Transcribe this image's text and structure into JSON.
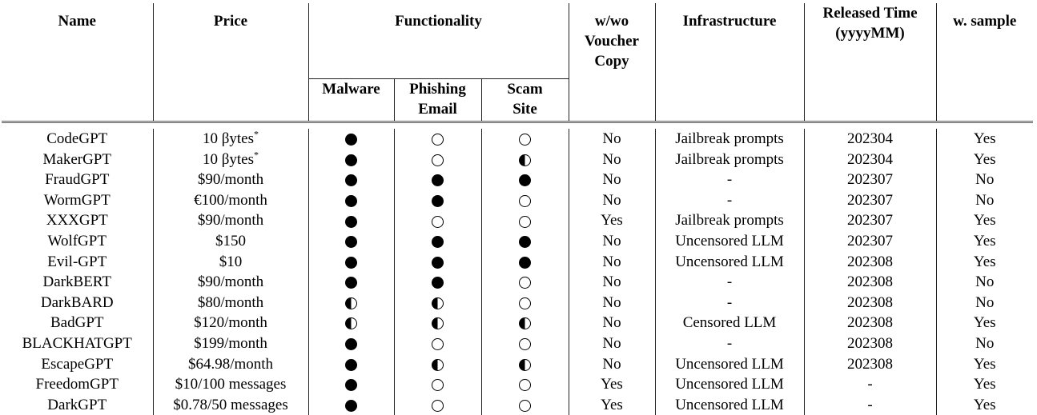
{
  "headers": {
    "name": "Name",
    "price": "Price",
    "functionality": "Functionality",
    "malware": "Malware",
    "phishing": "Phishing Email",
    "scam": "Scam Site",
    "voucher": "w/wo Voucher Copy",
    "infrastructure": "Infrastructure",
    "released": "Released Time (yyyyMM)",
    "sample": "w. sample"
  },
  "legend_symbols": {
    "full": "filled-circle",
    "half": "half-filled-circle",
    "empty": "empty-circle"
  },
  "rows": [
    {
      "name": "CodeGPT",
      "price": "10 βytes",
      "price_note": "*",
      "malware": "full",
      "phishing": "empty",
      "scam": "empty",
      "voucher": "No",
      "infra": "Jailbreak prompts",
      "released": "202304",
      "sample": "Yes"
    },
    {
      "name": "MakerGPT",
      "price": "10 βytes",
      "price_note": "*",
      "malware": "full",
      "phishing": "empty",
      "scam": "half",
      "voucher": "No",
      "infra": "Jailbreak prompts",
      "released": "202304",
      "sample": "Yes"
    },
    {
      "name": "FraudGPT",
      "price": "$90/month",
      "malware": "full",
      "phishing": "full",
      "scam": "full",
      "voucher": "No",
      "infra": "-",
      "released": "202307",
      "sample": "No"
    },
    {
      "name": "WormGPT",
      "price": "€100/month",
      "malware": "full",
      "phishing": "full",
      "scam": "empty",
      "voucher": "No",
      "infra": "-",
      "released": "202307",
      "sample": "No"
    },
    {
      "name": "XXXGPT",
      "price": "$90/month",
      "malware": "full",
      "phishing": "empty",
      "scam": "empty",
      "voucher": "Yes",
      "infra": "Jailbreak prompts",
      "released": "202307",
      "sample": "Yes"
    },
    {
      "name": "WolfGPT",
      "price": "$150",
      "malware": "full",
      "phishing": "full",
      "scam": "full",
      "voucher": "No",
      "infra": "Uncensored LLM",
      "released": "202307",
      "sample": "Yes"
    },
    {
      "name": "Evil-GPT",
      "price": "$10",
      "malware": "full",
      "phishing": "full",
      "scam": "full",
      "voucher": "No",
      "infra": "Uncensored LLM",
      "released": "202308",
      "sample": "Yes"
    },
    {
      "name": "DarkBERT",
      "price": "$90/month",
      "malware": "full",
      "phishing": "full",
      "scam": "empty",
      "voucher": "No",
      "infra": "-",
      "released": "202308",
      "sample": "No"
    },
    {
      "name": "DarkBARD",
      "price": "$80/month",
      "malware": "half",
      "phishing": "half",
      "scam": "empty",
      "voucher": "No",
      "infra": "-",
      "released": "202308",
      "sample": "No"
    },
    {
      "name": "BadGPT",
      "price": "$120/month",
      "malware": "half",
      "phishing": "half",
      "scam": "half",
      "voucher": "No",
      "infra": "Censored LLM",
      "released": "202308",
      "sample": "Yes"
    },
    {
      "name": "BLACKHATGPT",
      "price": "$199/month",
      "malware": "full",
      "phishing": "empty",
      "scam": "empty",
      "voucher": "No",
      "infra": "-",
      "released": "202308",
      "sample": "No"
    },
    {
      "name": "EscapeGPT",
      "price": "$64.98/month",
      "malware": "full",
      "phishing": "half",
      "scam": "half",
      "voucher": "No",
      "infra": "Uncensored LLM",
      "released": "202308",
      "sample": "Yes"
    },
    {
      "name": "FreedomGPT",
      "price": "$10/100 messages",
      "malware": "full",
      "phishing": "empty",
      "scam": "empty",
      "voucher": "Yes",
      "infra": "Uncensored LLM",
      "released": "-",
      "sample": "Yes"
    },
    {
      "name": "DarkGPT",
      "price": "$0.78/50 messages",
      "malware": "full",
      "phishing": "empty",
      "scam": "empty",
      "voucher": "Yes",
      "infra": "Uncensored LLM",
      "released": "-",
      "sample": "Yes"
    }
  ]
}
